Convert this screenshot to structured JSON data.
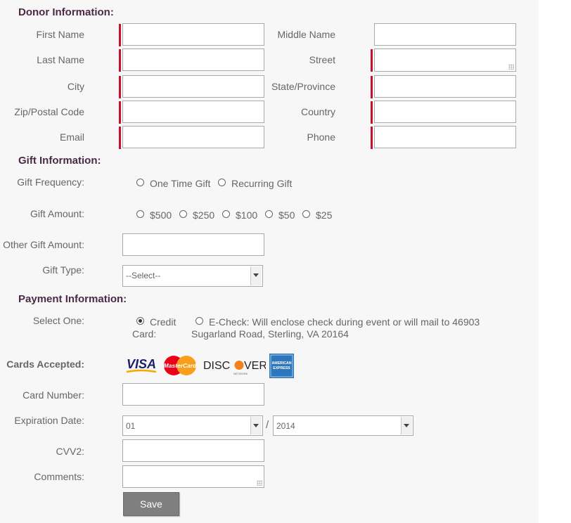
{
  "colors": {
    "required_marker": "#c8102e",
    "section_title": "#4a2a47",
    "button_bg": "#7f7f7f"
  },
  "donor": {
    "title": "Donor Information:",
    "first_name": "First Name",
    "middle_name": "Middle Name",
    "last_name": "Last Name",
    "street": "Street",
    "city": "City",
    "state": "State/Province",
    "zip": "Zip/Postal Code",
    "country": "Country",
    "email": "Email",
    "phone": "Phone"
  },
  "gift": {
    "title": "Gift Information:",
    "frequency_label": "Gift Frequency:",
    "frequency_options": [
      "One Time Gift",
      "Recurring Gift"
    ],
    "amount_label": "Gift Amount:",
    "amount_options": [
      "$500",
      "$250",
      "$100",
      "$50",
      "$25"
    ],
    "other_label": "Other Gift Amount:",
    "type_label": "Gift Type:",
    "type_selected": "--Select--"
  },
  "payment": {
    "title": "Payment Information:",
    "select_label": "Select One:",
    "option_credit_line1": "Credit",
    "option_credit_line2": "Card:",
    "option_echeck_line1": "E-Check: Will enclose check during event or will mail to 46903",
    "option_echeck_line2": "Sugarland Road, Sterling, VA 20164",
    "selected_option": "Credit Card",
    "cards_label": "Cards Accepted:",
    "cards": {
      "visa": "VISA",
      "mastercard": "MasterCard",
      "discover": "DISCOVER",
      "amex_line1": "AMERICAN",
      "amex_line2": "EXPRESS"
    },
    "card_number_label": "Card Number:",
    "expiration_label": "Expiration Date:",
    "exp_month": "01",
    "exp_separator": "/",
    "exp_year": "2014",
    "cvv_label": "CVV2:",
    "comments_label": "Comments:",
    "save_label": "Save"
  }
}
